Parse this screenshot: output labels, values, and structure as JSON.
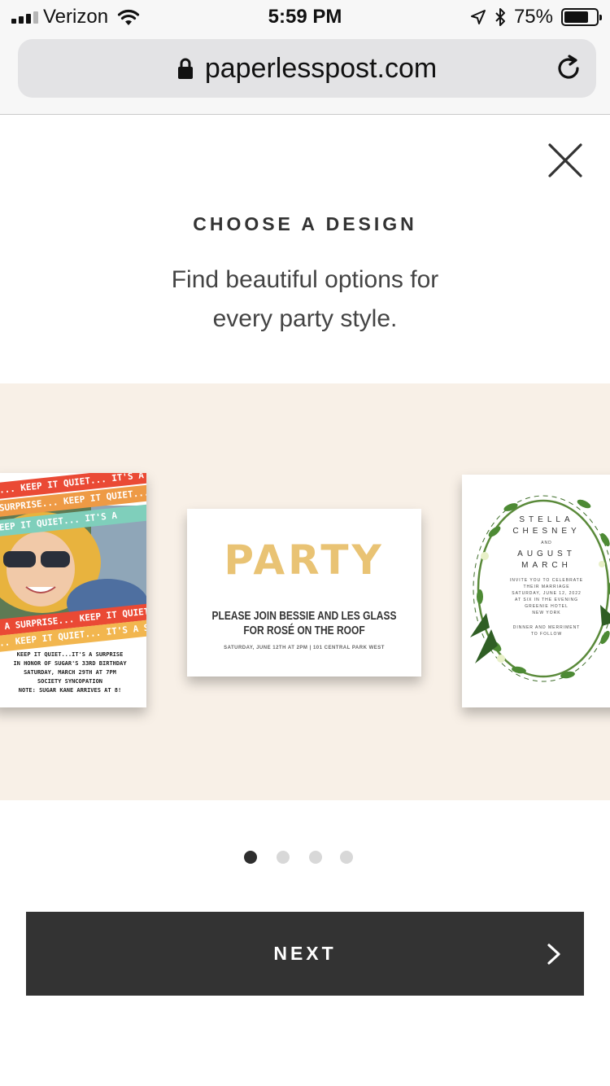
{
  "status_bar": {
    "carrier": "Verizon",
    "time": "5:59 PM",
    "battery_percent": "75%",
    "battery_level": 0.75,
    "icons": [
      "signal-icon",
      "wifi-icon",
      "location-icon",
      "bluetooth-icon",
      "battery-icon"
    ]
  },
  "browser": {
    "url": "paperlesspost.com",
    "icons": [
      "lock-icon",
      "reload-icon"
    ]
  },
  "onboarding": {
    "heading": "CHOOSE A DESIGN",
    "subtitle": "Find beautiful options for every party style.",
    "close_icon": "close-icon"
  },
  "carousel": {
    "background_color": "#f8f0e7",
    "cards": {
      "surprise": {
        "stripes": [
          "RISE... KEEP IT QUIET... IT'S A S",
          "S A SURPRISE... KEEP IT QUIET... IT'",
          "...KEEP IT QUIET... IT'S A",
          "IT'S A SURPRISE... KEEP IT QUIET... IT'S A SURP",
          "ISE... KEEP IT QUIET... IT'S A SURPRI"
        ],
        "lines": [
          "KEEP IT QUIET...IT'S A SURPRISE",
          "IN HONOR OF SUGAR'S 33RD BIRTHDAY",
          "SATURDAY, MARCH 29TH AT 7PM",
          "SOCIETY SYNCOPATION",
          "NOTE: SUGAR KANE ARRIVES AT 8!"
        ]
      },
      "party": {
        "title": "PARTY",
        "line1": "PLEASE JOIN BESSIE AND LES GLASS",
        "line2": "FOR ROSÉ ON THE ROOF",
        "details": "SATURDAY, JUNE 12TH AT 2PM | 101 CENTRAL PARK WEST"
      },
      "wedding": {
        "name1a": "STELLA",
        "name1b": "CHESNEY",
        "and": "AND",
        "name2a": "AUGUST",
        "name2b": "MARCH",
        "details": [
          "INVITE YOU TO CELEBRATE",
          "THEIR MARRIAGE",
          "SATURDAY, JUNE 12, 2022",
          "AT SIX IN THE EVENING",
          "GREENIE HOTEL",
          "NEW YORK"
        ],
        "footer": [
          "DINNER AND MERRIMENT",
          "TO FOLLOW"
        ]
      }
    }
  },
  "pagination": {
    "total": 4,
    "active_index": 0
  },
  "next_button": {
    "label": "NEXT",
    "icon": "chevron-right-icon"
  }
}
